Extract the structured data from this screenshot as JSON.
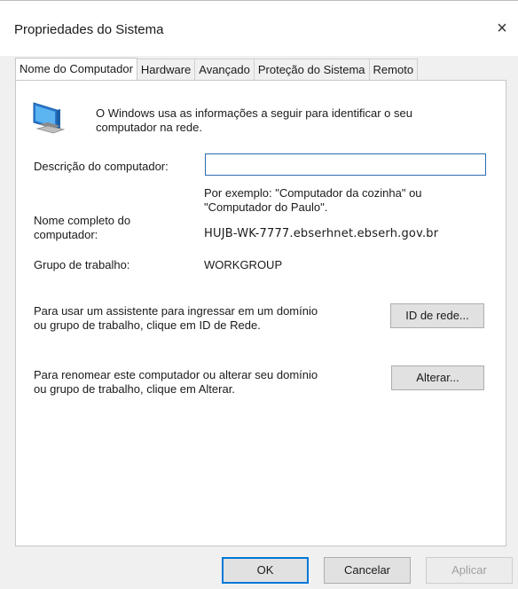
{
  "window": {
    "title": "Propriedades do Sistema",
    "close_glyph": "×"
  },
  "tabs": [
    {
      "label": "Nome do Computador",
      "active": true
    },
    {
      "label": "Hardware"
    },
    {
      "label": "Avançado"
    },
    {
      "label": "Proteção do Sistema"
    },
    {
      "label": "Remoto"
    }
  ],
  "info": {
    "icon": "computer-monitor-icon",
    "text_line1": "O Windows usa as informações a seguir para identificar o seu",
    "text_line2": "computador na rede."
  },
  "description": {
    "label": "Descrição do computador:",
    "value": "",
    "example_line1": "Por exemplo: \"Computador da cozinha\" ou",
    "example_line2": "\"Computador do Paulo\"."
  },
  "full_name": {
    "label_line1": "Nome completo do",
    "label_line2": "computador:",
    "value": "HUJB-WK-7777.ebserhnet.ebserh.gov.br"
  },
  "workgroup": {
    "label": "Grupo de trabalho:",
    "value": "WORKGROUP"
  },
  "network_id": {
    "text_line1": "Para usar um assistente para ingressar em um domínio",
    "text_line2": "ou grupo de trabalho, clique em ID de Rede.",
    "button_label": "ID de rede..."
  },
  "rename": {
    "text_line1": "Para renomear este computador ou alterar seu domínio",
    "text_line2": "ou grupo de trabalho, clique em Alterar.",
    "button_label": "Alterar..."
  },
  "footer": {
    "ok_label": "OK",
    "cancel_label": "Cancelar",
    "apply_label": "Aplicar"
  },
  "colors": {
    "accent": "#0078d7",
    "window_bg": "#f0f0f0",
    "panel_bg": "#ffffff"
  }
}
